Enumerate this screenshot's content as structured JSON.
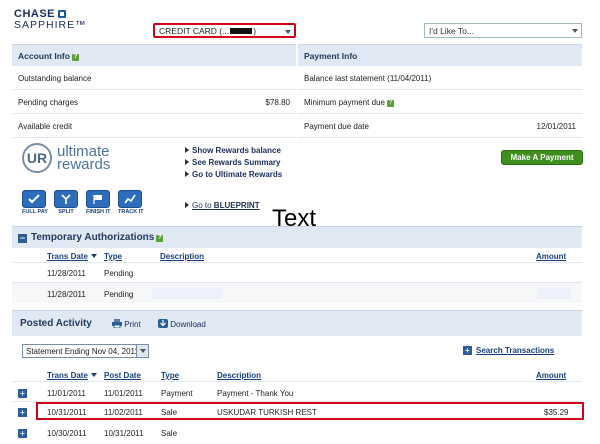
{
  "header": {
    "logo_line1": "CHASE",
    "logo_line2": "SAPPHIRE™",
    "account_select_prefix": "CREDIT CARD (...",
    "account_select_suffix": ")",
    "like_select": "I'd Like To..."
  },
  "account_info": {
    "title": "Account Info",
    "rows": [
      {
        "label": "Outstanding balance",
        "value": ""
      },
      {
        "label": "Pending charges",
        "value": "$78.80"
      },
      {
        "label": "Available credit",
        "value": ""
      }
    ]
  },
  "payment_info": {
    "title": "Payment Info",
    "rows": [
      {
        "label": "Balance last statement (11/04/2011)",
        "value": ""
      },
      {
        "label": "Minimum payment due",
        "value": ""
      },
      {
        "label": "Payment due date",
        "value": "12/01/2011"
      }
    ]
  },
  "rewards": {
    "logo_mark": "UR",
    "logo_text1": "ultimate",
    "logo_text2": "rewards",
    "links": [
      "Show Rewards balance",
      "See Rewards Summary",
      "Go to Ultimate Rewards"
    ],
    "make_payment": "Make A Payment",
    "tools": [
      "FULL PAY",
      "SPLIT",
      "FINISH IT",
      "TRACK IT"
    ],
    "blueprint_prefix": "Go to ",
    "blueprint_bold": "BLUEPRINT"
  },
  "overlay_text": "Text",
  "temp_auth": {
    "title": "Temporary Authorizations",
    "columns": [
      "Trans Date",
      "Type",
      "Description",
      "Amount"
    ],
    "rows": [
      {
        "date": "11/28/2011",
        "type": "Pending",
        "description": "",
        "amount": ""
      },
      {
        "date": "11/28/2011",
        "type": "Pending",
        "description": "",
        "amount": ""
      }
    ]
  },
  "posted": {
    "title": "Posted Activity",
    "print": "Print",
    "download": "Download",
    "statement_select": "Statement Ending Nov 04, 2011",
    "search": "Search Transactions",
    "columns": [
      "Trans Date",
      "Post Date",
      "Type",
      "Description",
      "Amount"
    ],
    "rows": [
      {
        "trans": "11/01/2011",
        "post": "11/01/2011",
        "type": "Payment",
        "description": "Payment - Thank You",
        "amount": ""
      },
      {
        "trans": "10/31/2011",
        "post": "11/02/2011",
        "type": "Sale",
        "description": "USKUDAR TURKISH REST",
        "amount": "$35.29"
      },
      {
        "trans": "10/30/2011",
        "post": "10/31/2011",
        "type": "Sale",
        "description": "",
        "amount": ""
      }
    ]
  },
  "colors": {
    "highlight": "#d0021b",
    "header_bg": "#dfe8f3",
    "button_green": "#3f8f1f",
    "brand_navy": "#1b2d5a"
  }
}
